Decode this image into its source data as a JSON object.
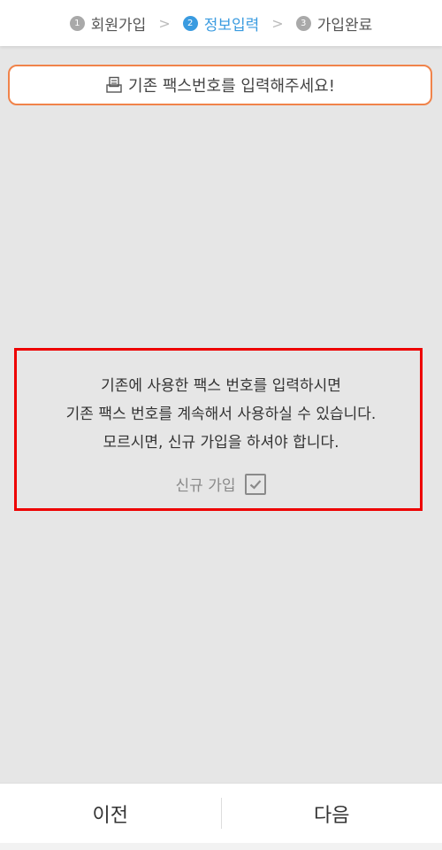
{
  "steps": [
    {
      "num": "1",
      "label": "회원가입"
    },
    {
      "num": "2",
      "label": "정보입력"
    },
    {
      "num": "3",
      "label": "가입완료"
    }
  ],
  "separator": ">",
  "notice": {
    "text": "기존 팩스번호를 입력해주세요!",
    "icon": "fax-document-icon"
  },
  "message": {
    "line1": "기존에 사용한 팩스 번호를 입력하시면",
    "line2": "기존 팩스 번호를 계속해서 사용하실 수 있습니다.",
    "line3": "모르시면, 신규 가입을 하셔야 합니다."
  },
  "new_join": {
    "label": "신규 가입",
    "checked": true
  },
  "nav": {
    "prev": "이전",
    "next": "다음"
  },
  "colors": {
    "active_step": "#3a9be0",
    "notice_border": "#f0834a",
    "highlight_border": "#ee0000"
  }
}
